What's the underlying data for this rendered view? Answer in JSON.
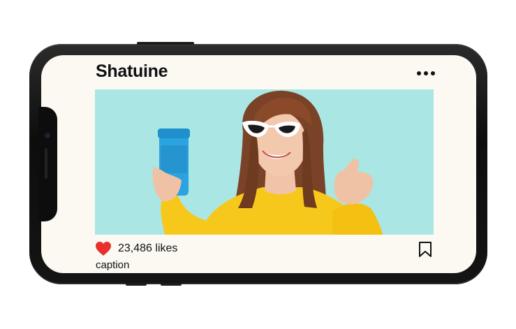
{
  "post": {
    "username": "Shatuine",
    "likes": "23,486 likes",
    "caption": "caption"
  },
  "icons": {
    "more": "more-horizontal-icon",
    "like": "heart-icon",
    "save": "bookmark-icon"
  },
  "colors": {
    "screen_bg": "#fbf9f2",
    "photo_bg": "#a9e6e4",
    "heart": "#e8302c",
    "sweater": "#f7c81c",
    "tumbler": "#2aa3e0",
    "phone_frame": "#111111"
  }
}
